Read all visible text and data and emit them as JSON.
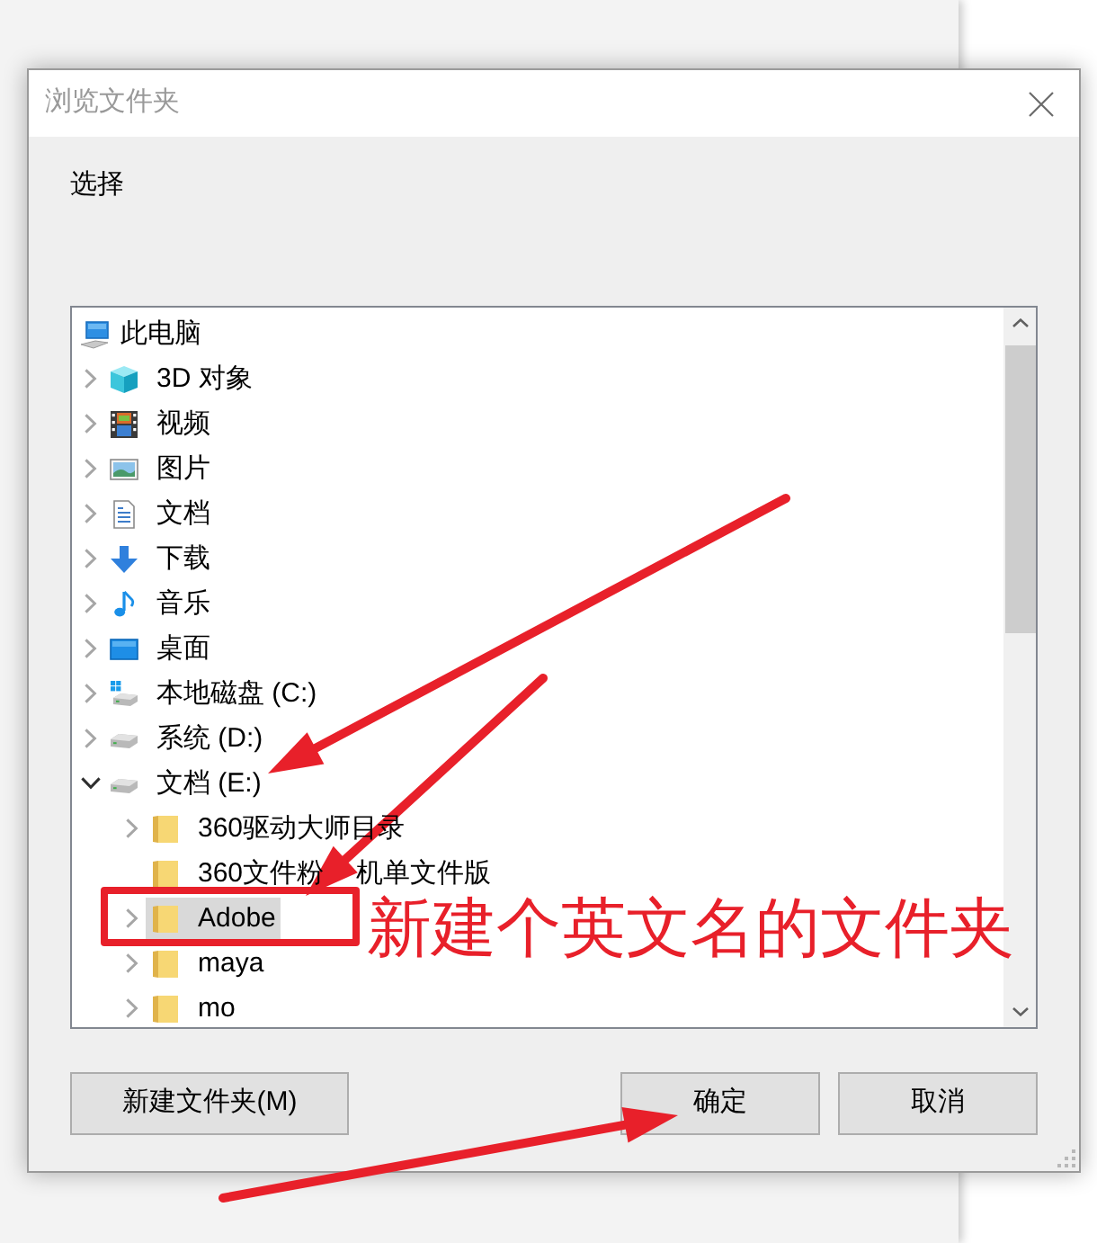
{
  "dialog": {
    "title": "浏览文件夹",
    "prompt": "选择"
  },
  "tree": [
    {
      "label": "此电脑",
      "kind": "computer",
      "expandable": false,
      "selected": false,
      "children": [
        {
          "label": "3D 对象",
          "kind": "cube",
          "expandable": true,
          "expanded": false,
          "selected": false
        },
        {
          "label": "视频",
          "kind": "film",
          "expandable": true,
          "expanded": false,
          "selected": false
        },
        {
          "label": "图片",
          "kind": "picture",
          "expandable": true,
          "expanded": false,
          "selected": false
        },
        {
          "label": "文档",
          "kind": "document",
          "expandable": true,
          "expanded": false,
          "selected": false
        },
        {
          "label": "下载",
          "kind": "download",
          "expandable": true,
          "expanded": false,
          "selected": false
        },
        {
          "label": "音乐",
          "kind": "music",
          "expandable": true,
          "expanded": false,
          "selected": false
        },
        {
          "label": "桌面",
          "kind": "desktop",
          "expandable": true,
          "expanded": false,
          "selected": false
        },
        {
          "label": "本地磁盘 (C:)",
          "kind": "system-drive",
          "expandable": true,
          "expanded": false,
          "selected": false
        },
        {
          "label": "系统 (D:)",
          "kind": "drive",
          "expandable": true,
          "expanded": false,
          "selected": false
        },
        {
          "label": "文档 (E:)",
          "kind": "drive",
          "expandable": true,
          "expanded": true,
          "selected": false,
          "children": [
            {
              "label": "360驱动大师目录",
              "kind": "folder",
              "expandable": true,
              "expanded": false,
              "selected": false
            },
            {
              "label": "360文件粉",
              "label_continued": "机单文件版",
              "kind": "folder",
              "expandable": false,
              "selected": false
            },
            {
              "label": "Adobe",
              "kind": "folder",
              "expandable": true,
              "expanded": false,
              "selected": true
            },
            {
              "label": "maya",
              "kind": "folder",
              "expandable": true,
              "expanded": false,
              "selected": false
            },
            {
              "label": "mo",
              "kind": "folder",
              "expandable": true,
              "expanded": false,
              "selected": false
            }
          ]
        }
      ]
    }
  ],
  "buttons": [
    {
      "label": "新建文件夹(M)"
    },
    {
      "label": "确定"
    },
    {
      "label": "取消"
    }
  ],
  "annotation": {
    "text": "新建个英文名的文件夹"
  }
}
